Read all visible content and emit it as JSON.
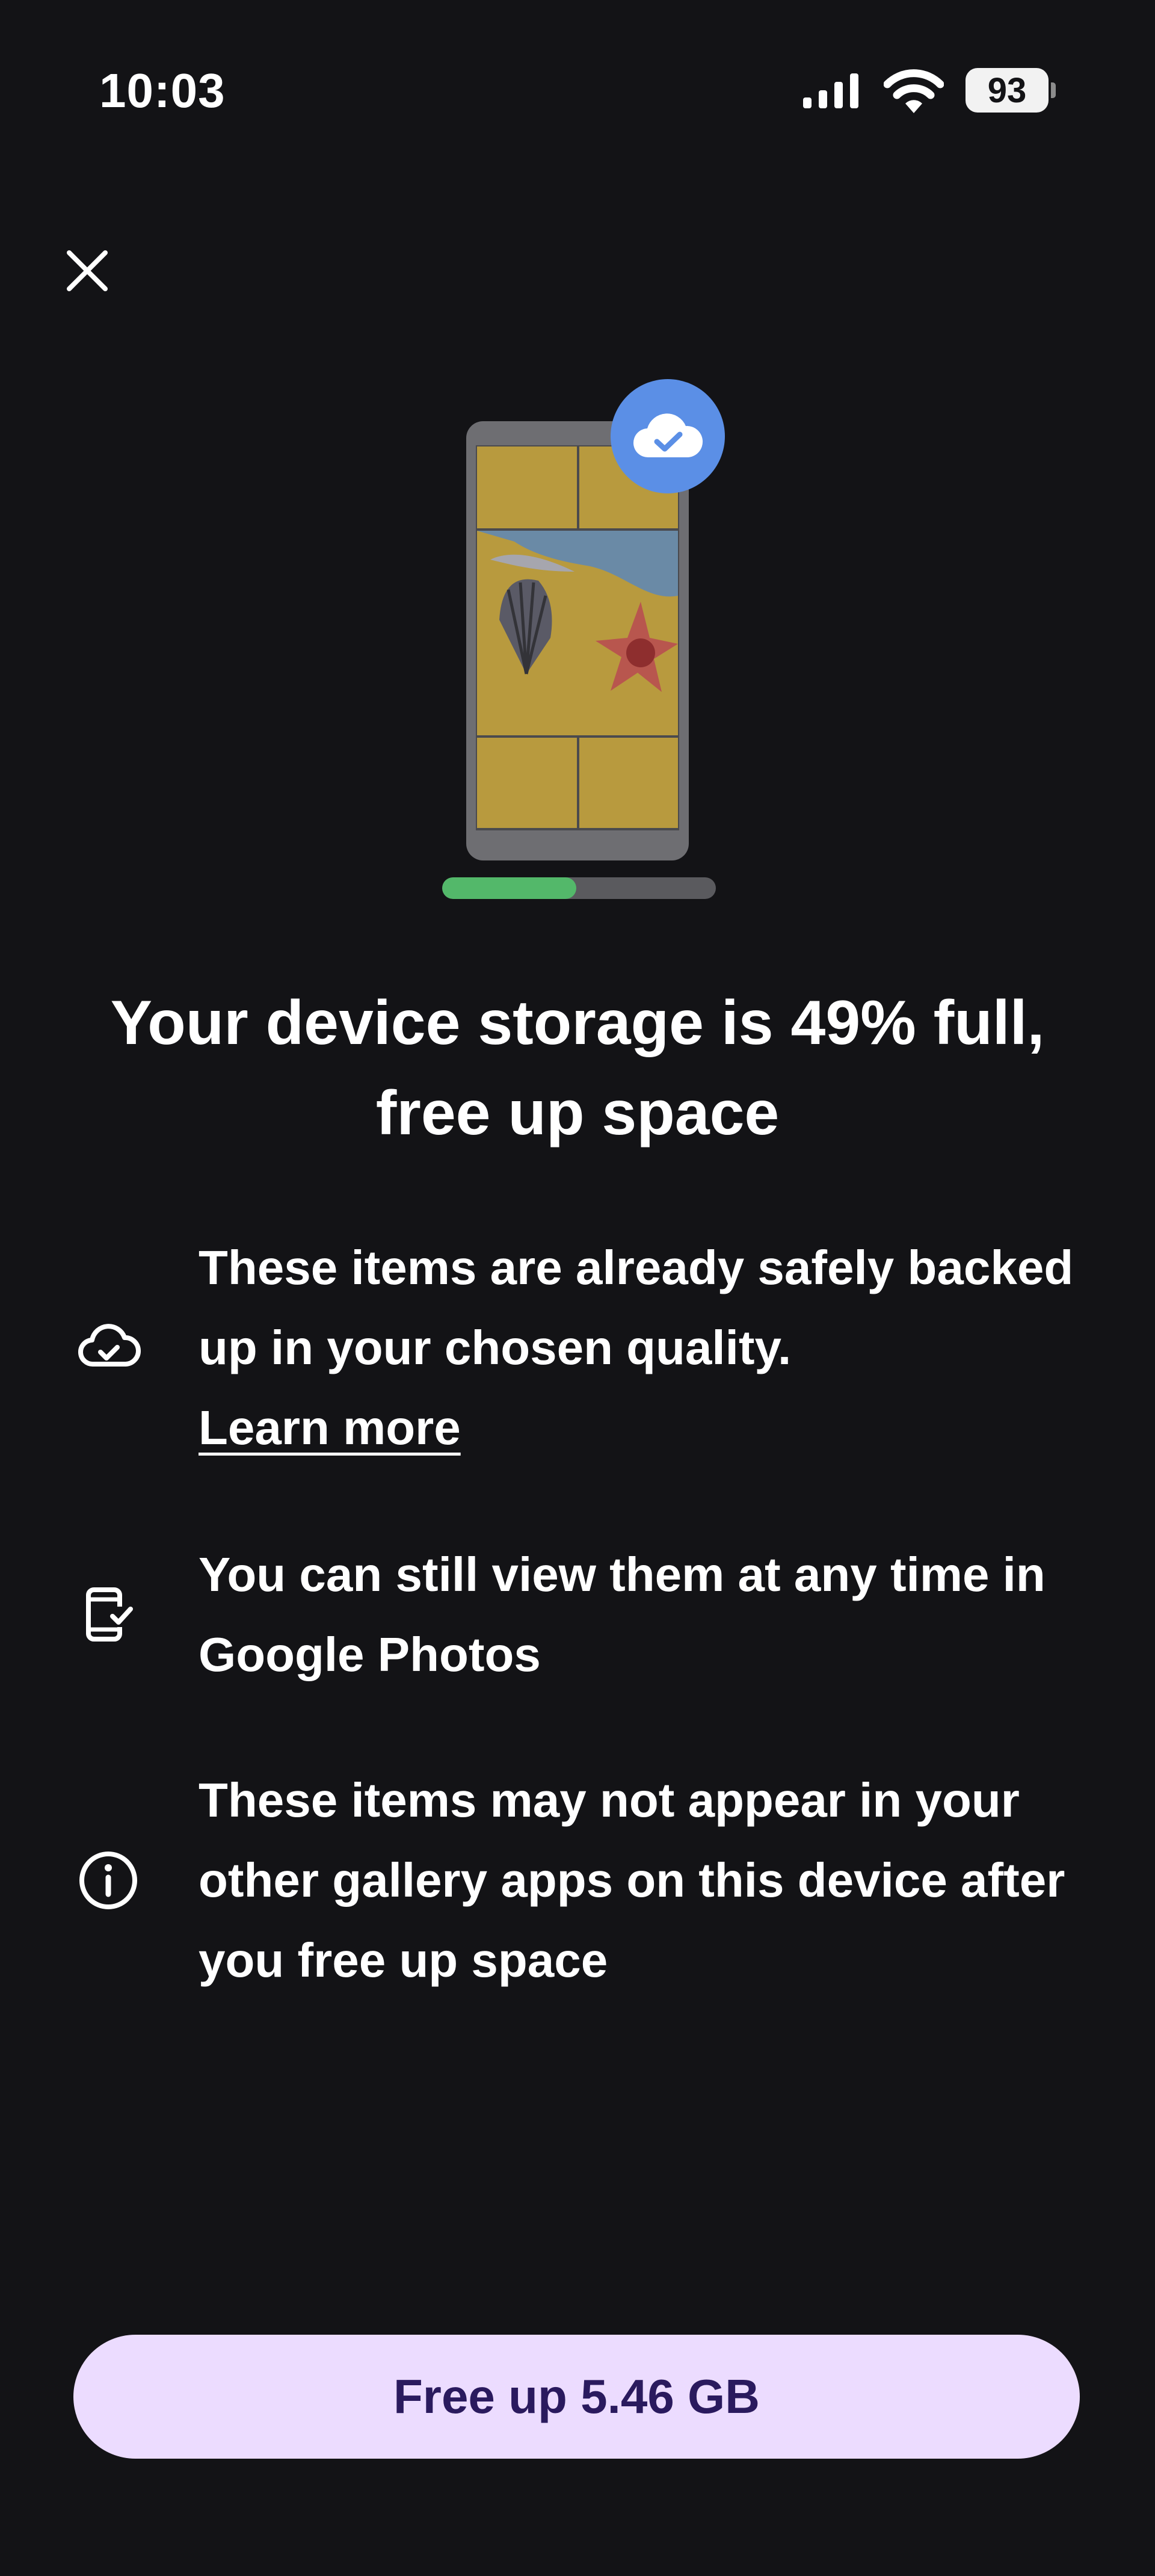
{
  "status_bar": {
    "time": "10:03",
    "battery_level": "93",
    "icons": [
      "signal-icon",
      "wifi-icon",
      "battery-icon"
    ]
  },
  "close": {
    "icon": "close-icon"
  },
  "illustration": {
    "badge_icon": "cloud-check-icon",
    "storage_fraction": 0.49
  },
  "title": "Your device storage is 49% full, free up space",
  "info": {
    "backed_up": {
      "icon": "cloud-check-outline-icon",
      "text": "These items are already safely backed up in your chosen quality.",
      "link": "Learn more"
    },
    "view_anytime": {
      "icon": "phone-check-icon",
      "text": "You can still view them at any time in Google Photos"
    },
    "gallery_warning": {
      "icon": "info-icon",
      "text": "These items may not appear in your other gallery apps on this device after you free up space"
    }
  },
  "action": {
    "label": "Free up 5.46 GB"
  },
  "colors": {
    "background": "#131316",
    "accent_button": "#ecdcff",
    "button_text": "#2a1a5e",
    "progress_fill": "#53b86a",
    "badge": "#5b8fe6"
  }
}
